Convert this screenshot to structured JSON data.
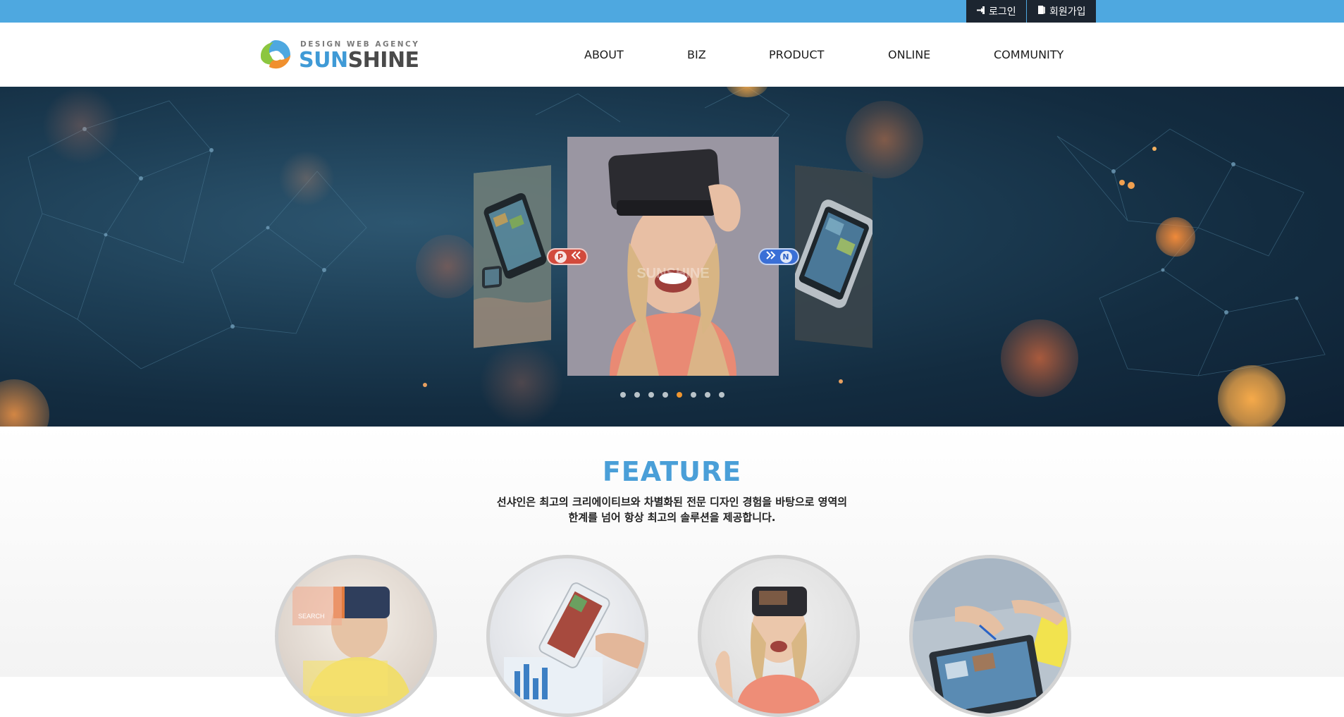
{
  "topbar": {
    "login_label": "로그인",
    "join_label": "회원가입"
  },
  "header": {
    "logo_sub": "DESIGN WEB AGENCY",
    "logo_sun": "SUN",
    "logo_shine": "SHINE",
    "nav": [
      {
        "label": "ABOUT"
      },
      {
        "label": "BIZ"
      },
      {
        "label": "PRODUCT"
      },
      {
        "label": "ONLINE"
      },
      {
        "label": "COMMUNITY"
      }
    ]
  },
  "hero": {
    "watermark": "SUNSHINE",
    "prev_badge": "P",
    "next_badge": "N",
    "dot_count": 8,
    "active_dot": 5
  },
  "feature": {
    "title": "FEATURE",
    "desc_line1": "선샤인은 최고의 크리에이티브와 차별화된 전문 디자인 경험을 바탕으로 영역의",
    "desc_line2": "한계를 넘어 항상 최고의 솔루션을 제공합니다.",
    "circle_text": "SEARCH"
  },
  "colors": {
    "topbar": "#4ea8e0",
    "accent": "#4a9fd8",
    "active_dot": "#f0962f",
    "prev_arrow": "#d24a3c",
    "next_arrow": "#3a6fd6"
  }
}
